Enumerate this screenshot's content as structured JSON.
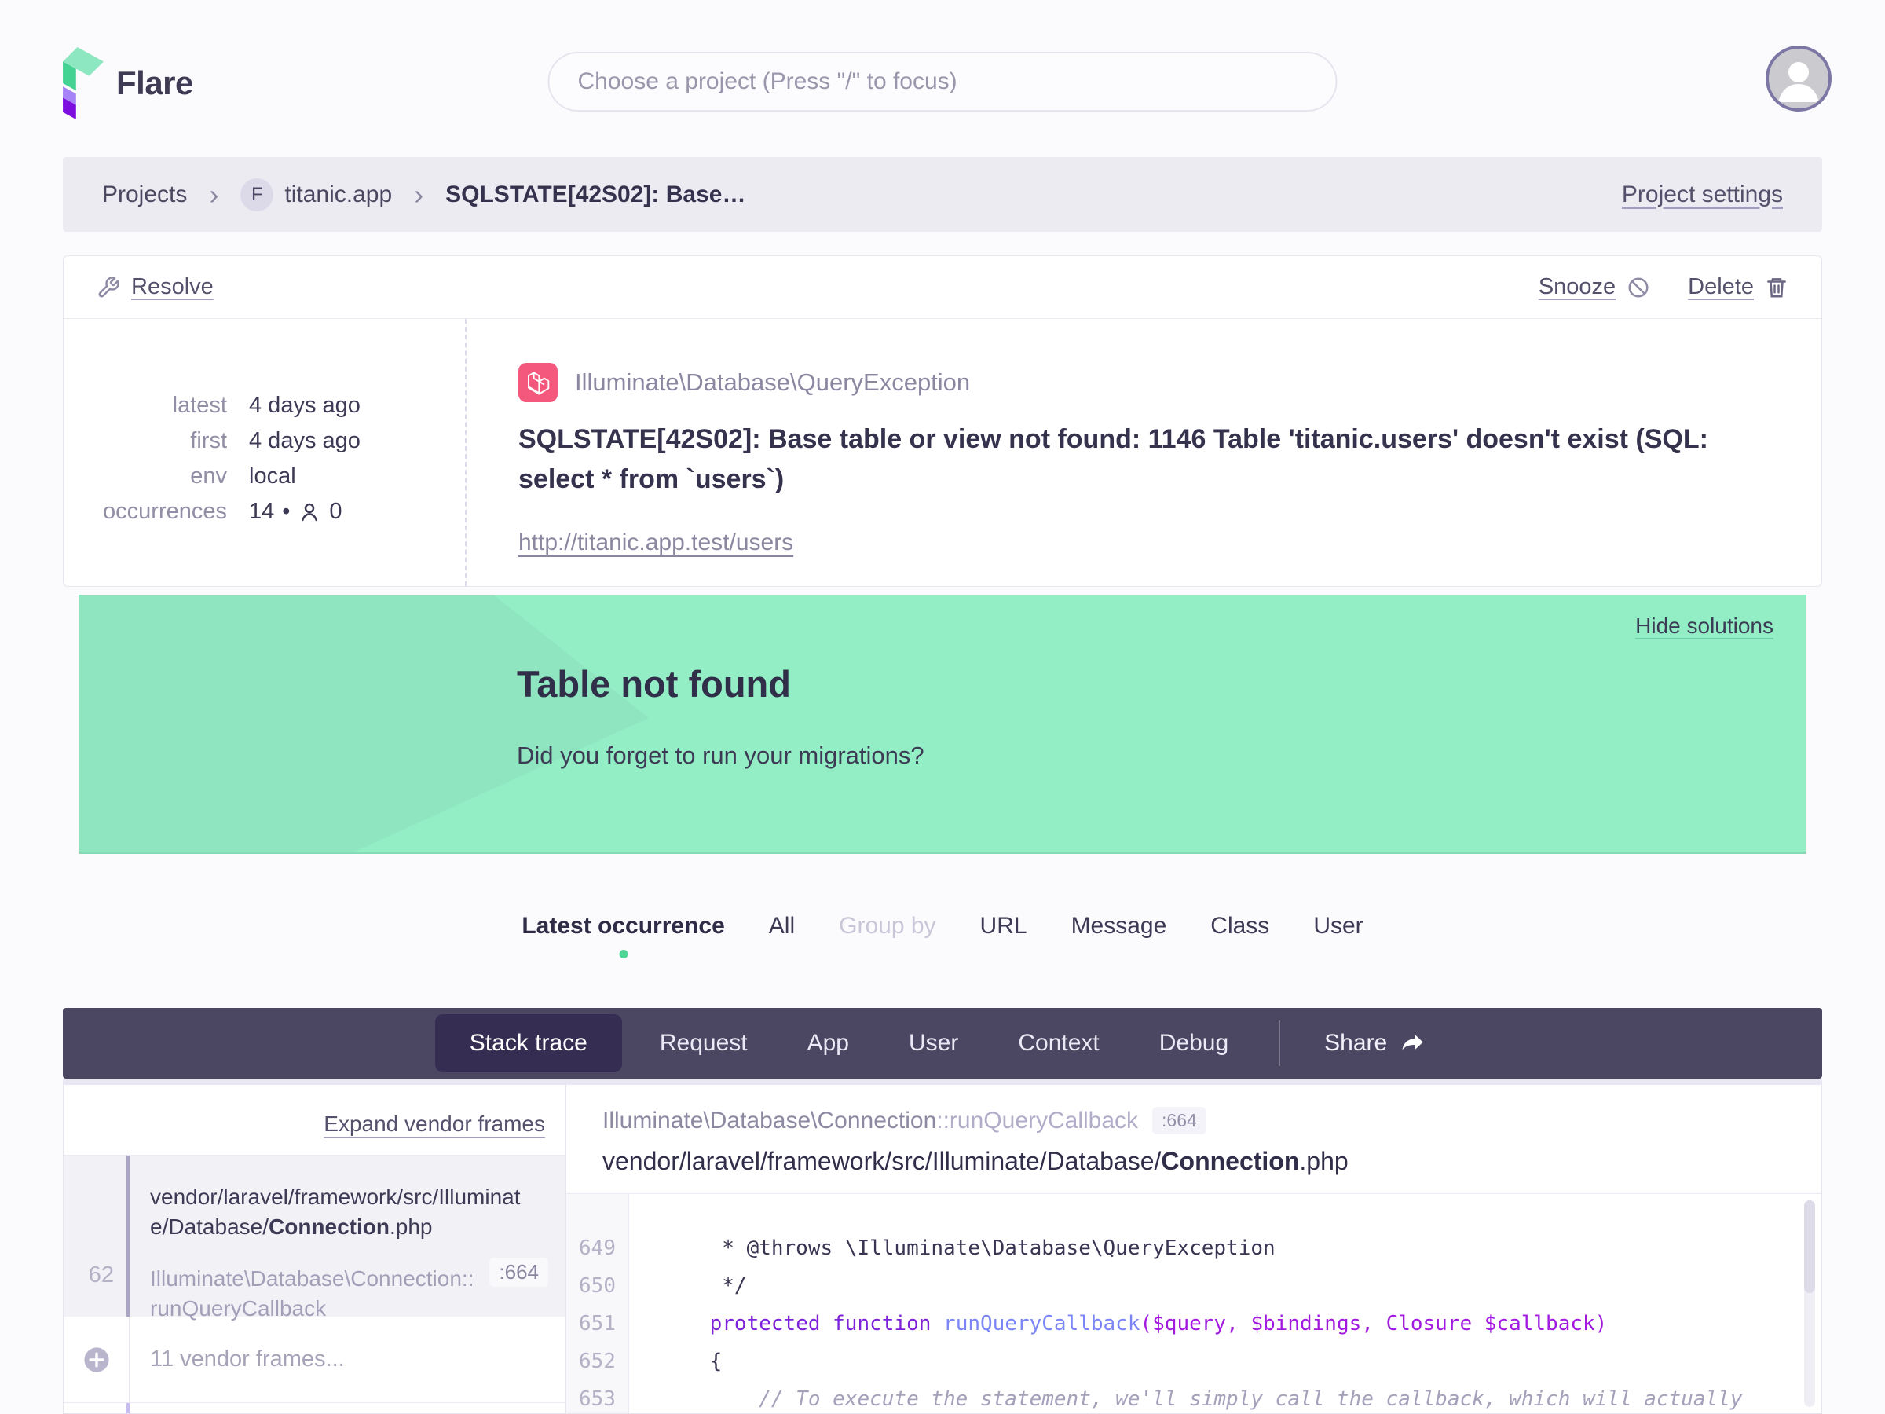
{
  "header": {
    "brand": "Flare",
    "search_placeholder": "Choose a project (Press \"/\" to focus)"
  },
  "breadcrumb": {
    "projects": "Projects",
    "project_badge": "F",
    "project": "titanic.app",
    "current": "SQLSTATE[42S02]: Base…",
    "settings": "Project settings"
  },
  "error_card": {
    "resolve": "Resolve",
    "snooze": "Snooze",
    "delete": "Delete",
    "meta": [
      {
        "label": "latest",
        "value": "4 days ago"
      },
      {
        "label": "first",
        "value": "4 days ago"
      },
      {
        "label": "env",
        "value": "local"
      },
      {
        "label": "occurrences",
        "value": "14"
      }
    ],
    "user_count": "0",
    "exception_class": "Illuminate\\Database\\QueryException",
    "message": "SQLSTATE[42S02]: Base table or view not found: 1146 Table 'titanic.users' doesn't exist (SQL: select * from `users`)",
    "url": "http://titanic.app.test/users"
  },
  "solution": {
    "hide": "Hide solutions",
    "title": "Table not found",
    "description": "Did you forget to run your migrations?"
  },
  "occurrence_tabs": {
    "items": [
      {
        "label": "Latest occurrence"
      },
      {
        "label": "All"
      },
      {
        "label": "Group by"
      },
      {
        "label": "URL"
      },
      {
        "label": "Message"
      },
      {
        "label": "Class"
      },
      {
        "label": "User"
      }
    ]
  },
  "detail_nav": {
    "tabs": [
      {
        "label": "Stack trace"
      },
      {
        "label": "Request"
      },
      {
        "label": "App"
      },
      {
        "label": "User"
      },
      {
        "label": "Context"
      },
      {
        "label": "Debug"
      }
    ],
    "share": "Share"
  },
  "stack_trace": {
    "expand": "Expand vendor frames",
    "frame_number": "62",
    "frame_dir": "vendor/laravel/framework/src/Illuminate/Database/",
    "frame_file": "Connection",
    "frame_ext": ".php",
    "frame_method": "Illuminate\\Database\\Connection::runQueryCallback",
    "frame_line": ":664",
    "vendor_frames": "11 vendor frames..."
  },
  "code_panel": {
    "method_class": "Illuminate\\Database\\Connection",
    "method_name": "::runQueryCallback",
    "line_badge": ":664",
    "file_dir": "vendor/laravel/framework/src/Illuminate/Database/",
    "file_name": "Connection",
    "file_ext": ".php",
    "lines": [
      {
        "no": "649",
        "plain": "     * @throws \\Illuminate\\Database\\QueryException"
      },
      {
        "no": "650",
        "plain": "     */"
      },
      {
        "no": "651",
        "indent": "    ",
        "kw": "protected function ",
        "fn": "runQueryCallback",
        "params": "($query, $bindings, Closure $callback)"
      },
      {
        "no": "652",
        "plain": "    {"
      },
      {
        "no": "653",
        "comment": "        // To execute the statement, we'll simply call the callback, which will actually"
      }
    ]
  },
  "colors": {
    "solution_green": "#93eec5",
    "navbar_purple": "#4b4662",
    "active_tab_purple": "#362e52",
    "laravel_pink": "#f4587c",
    "active_dot_green": "#4ed595"
  }
}
